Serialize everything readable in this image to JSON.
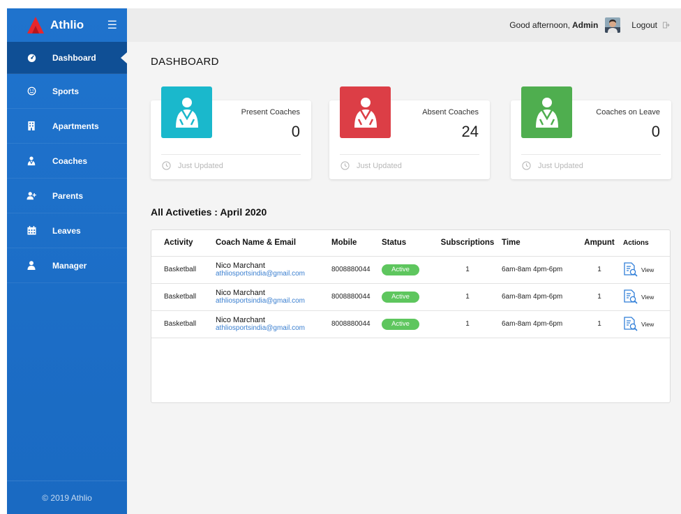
{
  "brand": {
    "name": "Athlio"
  },
  "sidebar": {
    "items": [
      {
        "label": "Dashboard",
        "icon": "gauge-icon"
      },
      {
        "label": "Sports",
        "icon": "smile-icon"
      },
      {
        "label": "Apartments",
        "icon": "building-icon"
      },
      {
        "label": "Coaches",
        "icon": "coach-icon"
      },
      {
        "label": "Parents",
        "icon": "user-plus-icon"
      },
      {
        "label": "Leaves",
        "icon": "calendar-icon"
      },
      {
        "label": "Manager",
        "icon": "user-icon"
      }
    ],
    "footer": "© 2019 Athlio"
  },
  "topbar": {
    "greeting": "Good afternoon,",
    "user": "Admin",
    "logout": "Logout"
  },
  "page": {
    "title": "DASHBOARD"
  },
  "stats": [
    {
      "label": "Present Coaches",
      "value": "0",
      "footer": "Just Updated",
      "color": "#1ab8cc"
    },
    {
      "label": "Absent Coaches",
      "value": "24",
      "footer": "Just Updated",
      "color": "#dc3e46"
    },
    {
      "label": "Coaches on Leave",
      "value": "0",
      "footer": "Just Updated",
      "color": "#4fae4f"
    }
  ],
  "activities": {
    "title": "All Activeties : April 2020",
    "headers": [
      "Activity",
      "Coach Name & Email",
      "Mobile",
      "Status",
      "Subscriptions",
      "Time",
      "Ampunt",
      "Actions"
    ],
    "rows": [
      {
        "activity": "Basketball",
        "coach_name": "Nico Marchant",
        "coach_email": "athliosportsindia@gmail.com",
        "mobile": "8008880044",
        "status": "Active",
        "subscriptions": "1",
        "time": "6am-8am 4pm-6pm",
        "amount": "1",
        "action": "View"
      },
      {
        "activity": "Basketball",
        "coach_name": "Nico Marchant",
        "coach_email": "athliosportsindia@gmail.com",
        "mobile": "8008880044",
        "status": "Active",
        "subscriptions": "1",
        "time": "6am-8am 4pm-6pm",
        "amount": "1",
        "action": "View"
      },
      {
        "activity": "Basketball",
        "coach_name": "Nico Marchant",
        "coach_email": "athliosportsindia@gmail.com",
        "mobile": "8008880044",
        "status": "Active",
        "subscriptions": "1",
        "time": "6am-8am 4pm-6pm",
        "amount": "1",
        "action": "View"
      }
    ]
  },
  "colors": {
    "sidebar": "#1d6fc9",
    "sidebar_active": "#0f4f95",
    "status_active": "#5ec65e",
    "link": "#3a7fd0"
  }
}
